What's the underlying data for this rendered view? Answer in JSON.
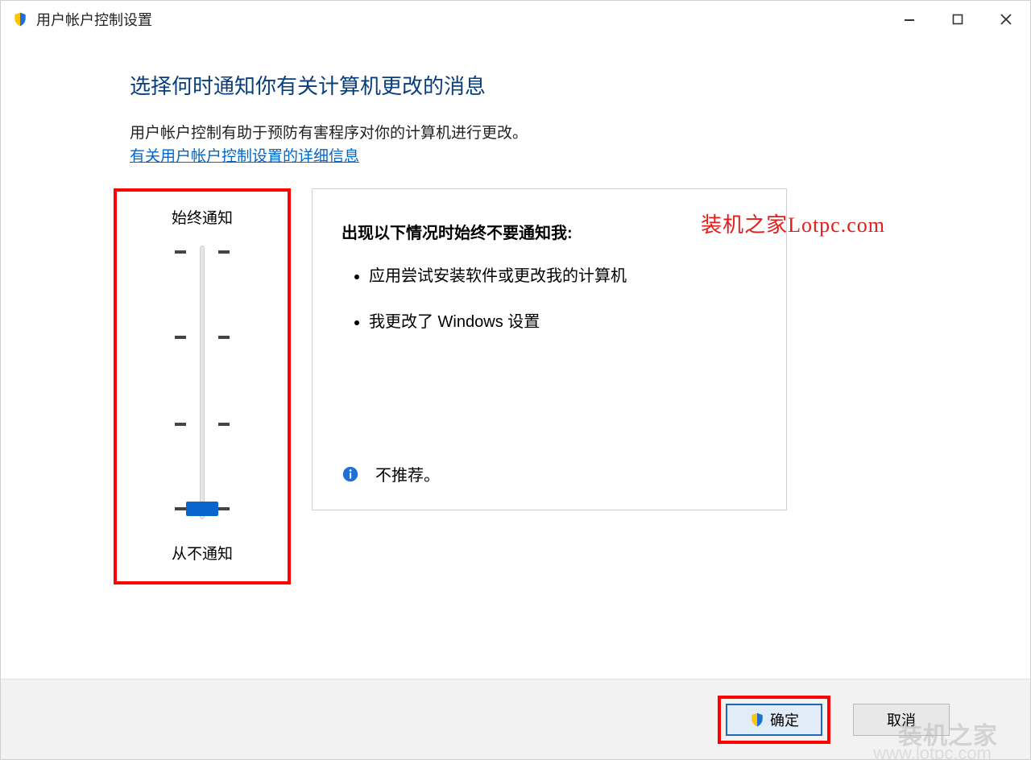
{
  "window": {
    "title": "用户帐户控制设置"
  },
  "header": {
    "heading": "选择何时通知你有关计算机更改的消息",
    "intro": "用户帐户控制有助于预防有害程序对你的计算机进行更改。",
    "help_link": "有关用户帐户控制设置的详细信息"
  },
  "slider": {
    "top_label": "始终通知",
    "bottom_label": "从不通知",
    "position": 3
  },
  "description": {
    "heading": "出现以下情况时始终不要通知我:",
    "bullets": [
      "应用尝试安装软件或更改我的计算机",
      "我更改了 Windows 设置"
    ],
    "recommendation": "不推荐。"
  },
  "watermark": "装机之家Lotpc.com",
  "footer": {
    "ok": "确定",
    "cancel": "取消"
  },
  "background_watermark": {
    "line1": "装机之家",
    "line2": "www.lotpc.com"
  }
}
